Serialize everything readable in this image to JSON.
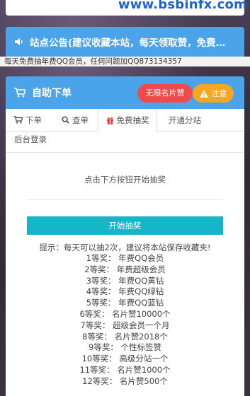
{
  "site": {
    "watermark": "www.bsbinfx.com"
  },
  "notice": {
    "text": "站点公告(建议收藏本站，每天领取赞，免费…"
  },
  "marquee": {
    "text": "每天免费抽年费QQ会员，任何问题加QQ873134357"
  },
  "panel": {
    "title": "自助下单",
    "badge_red": "无限名片赞",
    "badge_orange": "注意"
  },
  "tabs": [
    {
      "label": "下单",
      "icon": "cart-icon"
    },
    {
      "label": "查单",
      "icon": "search-icon"
    },
    {
      "label": "免费抽奖",
      "icon": "gift-icon"
    },
    {
      "label": "开通分站",
      "icon": ""
    },
    {
      "label": "后台登录",
      "icon": ""
    }
  ],
  "lottery": {
    "hint": "点击下方按钮开始抽奖",
    "button": "开始抽奖",
    "tip": "提示：每天可以抽2次，建议将本站保存收藏夹!",
    "prizes": [
      "1等奖：  年费QQ会员",
      "2等奖：  年费超级会员",
      "3等奖：  年费QQ黄钻",
      "4等奖：  年费QQ绿钻",
      "5等奖：  年费QQ蓝钻",
      "6等奖：  名片赞10000个",
      "7等奖：  超级会员一个月",
      "8等奖：  名片赞2018个",
      "9等奖：  个性标签赞",
      "10等奖：  高级分站一个",
      "11等奖：  名片赞1000个",
      "12等奖：  名片赞500个"
    ]
  },
  "colors": {
    "primary": "#4ba3ea",
    "danger": "#ee4b4b",
    "warning": "#f5a623",
    "button": "#14b6c8"
  }
}
